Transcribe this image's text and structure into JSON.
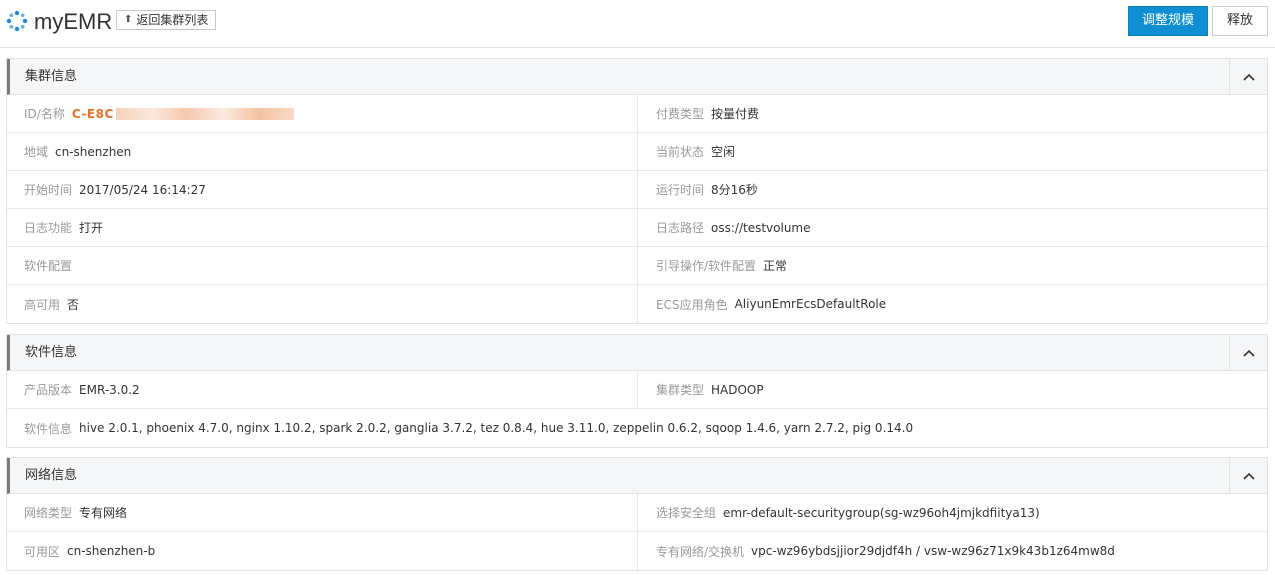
{
  "header": {
    "app_title": "myEMR",
    "back_label": "返回集群列表",
    "resize_label": "调整规模",
    "release_label": "释放"
  },
  "cluster_info": {
    "title": "集群信息",
    "rows": [
      [
        {
          "label": "ID/名称",
          "value": "C-E8C"
        },
        {
          "label": "付费类型",
          "value": "按量付费"
        }
      ],
      [
        {
          "label": "地域",
          "value": "cn-shenzhen"
        },
        {
          "label": "当前状态",
          "value": "空闲"
        }
      ],
      [
        {
          "label": "开始时间",
          "value": "2017/05/24 16:14:27"
        },
        {
          "label": "运行时间",
          "value": "8分16秒"
        }
      ],
      [
        {
          "label": "日志功能",
          "value": "打开"
        },
        {
          "label": "日志路径",
          "value": "oss://testvolume"
        }
      ],
      [
        {
          "label": "软件配置",
          "value": ""
        },
        {
          "label": "引导操作/软件配置",
          "value": "正常"
        }
      ],
      [
        {
          "label": "高可用",
          "value": "否"
        },
        {
          "label": "ECS应用角色",
          "value": "AliyunEmrEcsDefaultRole"
        }
      ]
    ]
  },
  "software_info": {
    "title": "软件信息",
    "rows": [
      [
        {
          "label": "产品版本",
          "value": "EMR-3.0.2"
        },
        {
          "label": "集群类型",
          "value": "HADOOP"
        }
      ]
    ],
    "software_row": {
      "label": "软件信息",
      "value": "hive 2.0.1, phoenix 4.7.0, nginx 1.10.2, spark 2.0.2, ganglia 3.7.2, tez 0.8.4, hue 3.11.0, zeppelin 0.6.2, sqoop 1.4.6, yarn 2.7.2, pig 0.14.0"
    }
  },
  "network_info": {
    "title": "网络信息",
    "rows": [
      [
        {
          "label": "网络类型",
          "value": "专有网络"
        },
        {
          "label": "选择安全组",
          "value": "emr-default-securitygroup(sg-wz96oh4jmjkdfiitya13)"
        }
      ],
      [
        {
          "label": "可用区",
          "value": "cn-shenzhen-b"
        },
        {
          "label": "专有网络/交换机",
          "value": "vpc-wz96ybdsjjior29djdf4h / vsw-wz96z71x9k43b1z64mw8d"
        }
      ]
    ]
  },
  "colors": {
    "primary": "#0f8ed1",
    "id_accent": "#e8712b",
    "logo": "#1a8ad9"
  }
}
